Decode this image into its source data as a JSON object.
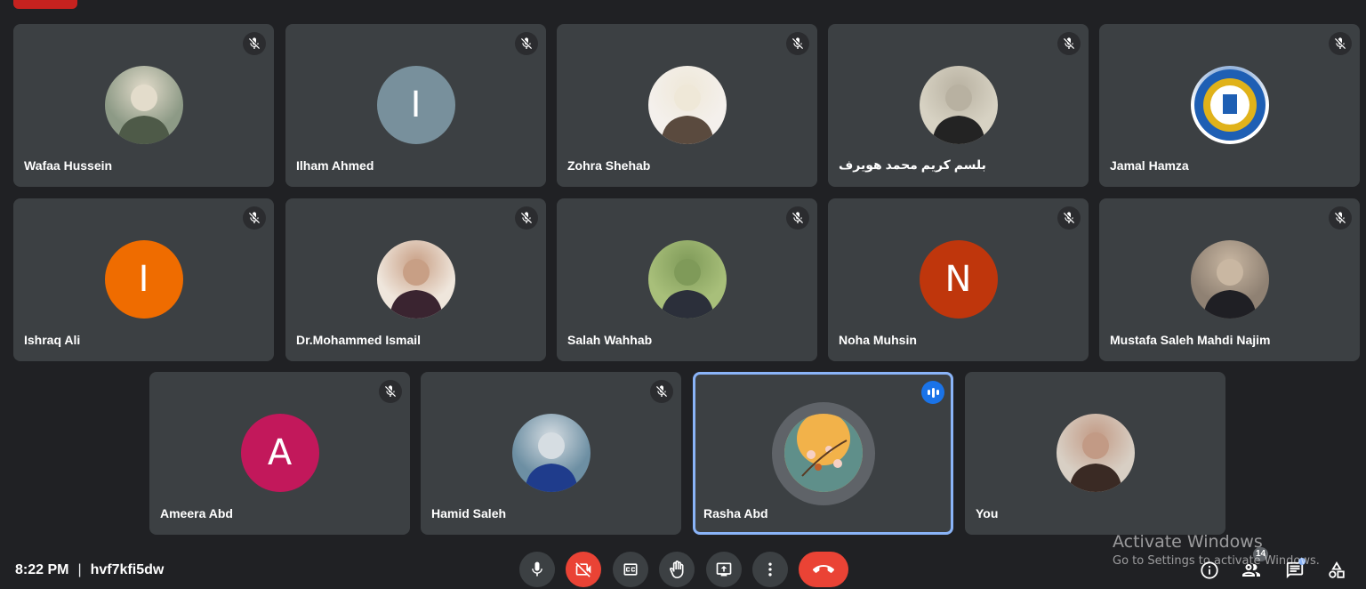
{
  "participants": [
    {
      "name": "Wafaa Hussein",
      "avatar": {
        "kind": "photo",
        "icon": "person-photo",
        "colors": [
          "#8d9a86",
          "#e3dccb",
          "#4e5a48"
        ]
      },
      "muted": true
    },
    {
      "name": "Ilham Ahmed",
      "avatar": {
        "kind": "initial",
        "initial": "I",
        "color": "#78909c"
      },
      "muted": true
    },
    {
      "name": "Zohra Shehab",
      "avatar": {
        "kind": "photo",
        "icon": "person-photo",
        "colors": [
          "#f4f0ec",
          "#efe8d8",
          "#5a4a3e"
        ]
      },
      "muted": true
    },
    {
      "name": "بلسم كريم محمد هويرف",
      "avatar": {
        "kind": "photo",
        "icon": "person-photo",
        "colors": [
          "#d7d2c3",
          "#b8b1a1",
          "#232323"
        ]
      },
      "muted": true
    },
    {
      "name": "Jamal Hamza",
      "avatar": {
        "kind": "logo",
        "icon": "university-logo",
        "colors": [
          "#ffffff",
          "#1e5fb4",
          "#e0b21a"
        ]
      },
      "muted": true
    },
    {
      "name": "Ishraq Ali",
      "avatar": {
        "kind": "initial",
        "initial": "I",
        "color": "#ef6c00"
      },
      "muted": true
    },
    {
      "name": "Dr.Mohammed Ismail",
      "avatar": {
        "kind": "photo",
        "icon": "person-photo",
        "colors": [
          "#efe6dc",
          "#c89f85",
          "#3a2430"
        ]
      },
      "muted": true
    },
    {
      "name": "Salah Wahhab",
      "avatar": {
        "kind": "photo",
        "icon": "person-photo",
        "colors": [
          "#a8bf7a",
          "#7f9a59",
          "#2b2f3a"
        ]
      },
      "muted": true
    },
    {
      "name": "Noha Muhsin",
      "avatar": {
        "kind": "initial",
        "initial": "N",
        "color": "#bf360c"
      },
      "muted": true
    },
    {
      "name": "Mustafa Saleh Mahdi Najim",
      "avatar": {
        "kind": "photo",
        "icon": "person-photo",
        "colors": [
          "#8f8173",
          "#c9b7a2",
          "#1f1f24"
        ]
      },
      "muted": true
    },
    {
      "name": "Ameera Abd",
      "avatar": {
        "kind": "initial",
        "initial": "A",
        "color": "#c2185b"
      },
      "muted": true
    },
    {
      "name": "Hamid Saleh",
      "avatar": {
        "kind": "photo",
        "icon": "person-photo",
        "colors": [
          "#6d8fa3",
          "#d6dde2",
          "#1f3c8c"
        ]
      },
      "muted": true
    },
    {
      "name": "Rasha Abd",
      "avatar": {
        "kind": "photo",
        "icon": "blossom-photo",
        "colors": [
          "#f2b24a",
          "#c0602a",
          "#5f8f8a"
        ]
      },
      "muted": false,
      "speaking": true
    },
    {
      "name": "You",
      "avatar": {
        "kind": "photo",
        "icon": "person-photo",
        "colors": [
          "#d8cfc4",
          "#c29a85",
          "#3a2a24"
        ]
      },
      "muted": false
    }
  ],
  "footer": {
    "time": "8:22 PM",
    "separator": "|",
    "meeting_code": "hvf7kfi5dw",
    "people_count": "14"
  },
  "controls": [
    {
      "name": "microphone-button",
      "icon": "mic-icon"
    },
    {
      "name": "camera-off-button",
      "icon": "camera-off-icon"
    },
    {
      "name": "captions-button",
      "icon": "closed-captions-icon"
    },
    {
      "name": "raise-hand-button",
      "icon": "hand-icon"
    },
    {
      "name": "present-screen-button",
      "icon": "present-icon"
    },
    {
      "name": "more-options-button",
      "icon": "more-vert-icon"
    },
    {
      "name": "leave-call-button",
      "icon": "call-end-icon"
    }
  ],
  "side_controls": [
    {
      "name": "meeting-details-button",
      "icon": "info-icon"
    },
    {
      "name": "people-button",
      "icon": "people-icon"
    },
    {
      "name": "chat-button",
      "icon": "chat-icon"
    },
    {
      "name": "activities-button",
      "icon": "activities-icon"
    }
  ],
  "watermark": {
    "title": "Activate Windows",
    "subtitle": "Go to Settings to activate Windows."
  },
  "colors": {
    "background": "#202124",
    "tile": "#3c4043",
    "speaking_border": "#8ab4f8",
    "danger": "#ea4335"
  }
}
